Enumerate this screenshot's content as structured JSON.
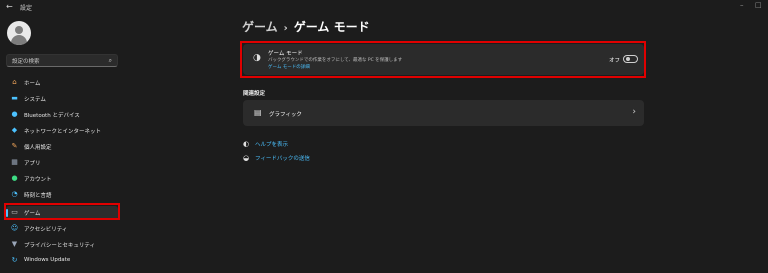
{
  "window": {
    "title": "設定",
    "back_glyph": "←",
    "minimize_glyph": "–",
    "maximize_glyph": "□"
  },
  "search": {
    "placeholder": "設定の検索",
    "icon": "search-icon"
  },
  "nav": {
    "items": [
      {
        "label": "ホーム",
        "icon": "home-icon",
        "color": "#f2a65a"
      },
      {
        "label": "システム",
        "icon": "system-icon",
        "color": "#4cc2ff"
      },
      {
        "label": "Bluetooth とデバイス",
        "icon": "bluetooth-icon",
        "color": "#4cc2ff"
      },
      {
        "label": "ネットワークとインターネット",
        "icon": "network-icon",
        "color": "#4cc2ff"
      },
      {
        "label": "個人用設定",
        "icon": "brush-icon",
        "color": "#f2a65a"
      },
      {
        "label": "アプリ",
        "icon": "apps-icon",
        "color": "#9aa6b8"
      },
      {
        "label": "アカウント",
        "icon": "account-icon",
        "color": "#3ddc84"
      },
      {
        "label": "時刻と言語",
        "icon": "time-language-icon",
        "color": "#4cc2ff"
      },
      {
        "label": "ゲーム",
        "icon": "gaming-icon",
        "color": "#cfcfcf",
        "active": true
      },
      {
        "label": "アクセシビリティ",
        "icon": "accessibility-icon",
        "color": "#4cc2ff"
      },
      {
        "label": "プライバシーとセキュリティ",
        "icon": "shield-icon",
        "color": "#9aa6b8"
      },
      {
        "label": "Windows Update",
        "icon": "windows-update-icon",
        "color": "#4cc2ff"
      }
    ]
  },
  "breadcrumb": {
    "parent": "ゲーム",
    "separator": "›",
    "current": "ゲーム モード"
  },
  "game_mode": {
    "title": "ゲーム モード",
    "description": "バックグラウンドでの作業をオフにして、最適な PC を保護します",
    "link": "ゲーム モードの詳細",
    "state_label": "オフ",
    "enabled": false
  },
  "related": {
    "header": "関連設定",
    "graphics_label": "グラフィック",
    "chevron": "›"
  },
  "links": {
    "help": "ヘルプを表示",
    "feedback": "フィードバックの送信"
  },
  "colors": {
    "accent": "#4cc2ff",
    "highlight": "#e00000",
    "background": "#1c1c1c",
    "card": "#2b2b2b"
  }
}
